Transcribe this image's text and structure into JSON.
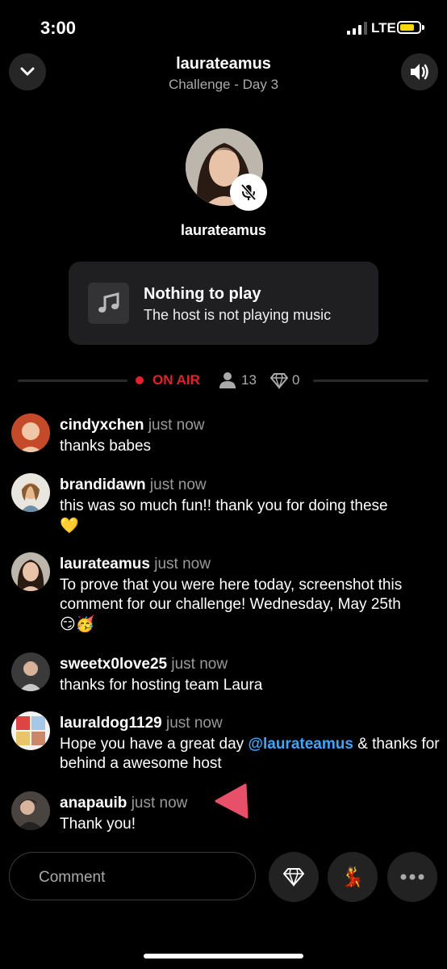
{
  "status_bar": {
    "time": "3:00",
    "network": "LTE",
    "battery_color": "#f5d90a"
  },
  "header": {
    "title": "laurateamus",
    "subtitle": "Challenge - Day 3",
    "collapse_icon": "chevron-down-icon",
    "sound_icon": "speaker-icon"
  },
  "host": {
    "name": "laurateamus",
    "mic_state": "muted"
  },
  "music": {
    "title": "Nothing to play",
    "subtitle": "The host is not playing music",
    "icon": "music-note-icon"
  },
  "live": {
    "label": "ON AIR",
    "viewers": "13",
    "diamonds": "0",
    "accent": "#e0212f"
  },
  "comments": [
    {
      "user": "cindyxchen",
      "time": "just now",
      "text": "thanks babes"
    },
    {
      "user": "brandidawn",
      "time": "just now",
      "text": "this was so much fun!! thank you for doing these",
      "emoji": "💛"
    },
    {
      "user": "laurateamus",
      "time": "just now",
      "text": "To prove that you were here today, screenshot this comment for our challenge! Wednesday, May 25th",
      "emoji": "😏🥳"
    },
    {
      "user": "sweetx0love25",
      "time": "just now",
      "text": "thanks for hosting team Laura"
    },
    {
      "user": "lauraldog1129",
      "time": "just now",
      "text_before": "Hope you have a great day",
      "mention": "@laurateamus",
      "text_after": "& thanks for behind a awesome host"
    },
    {
      "user": "anapauib",
      "time": "just now",
      "text": "Thank you!"
    }
  ],
  "composer": {
    "placeholder": "Comment",
    "gift_icon": "diamond-icon",
    "emoji_button": "💃",
    "more_icon": "more-icon"
  }
}
